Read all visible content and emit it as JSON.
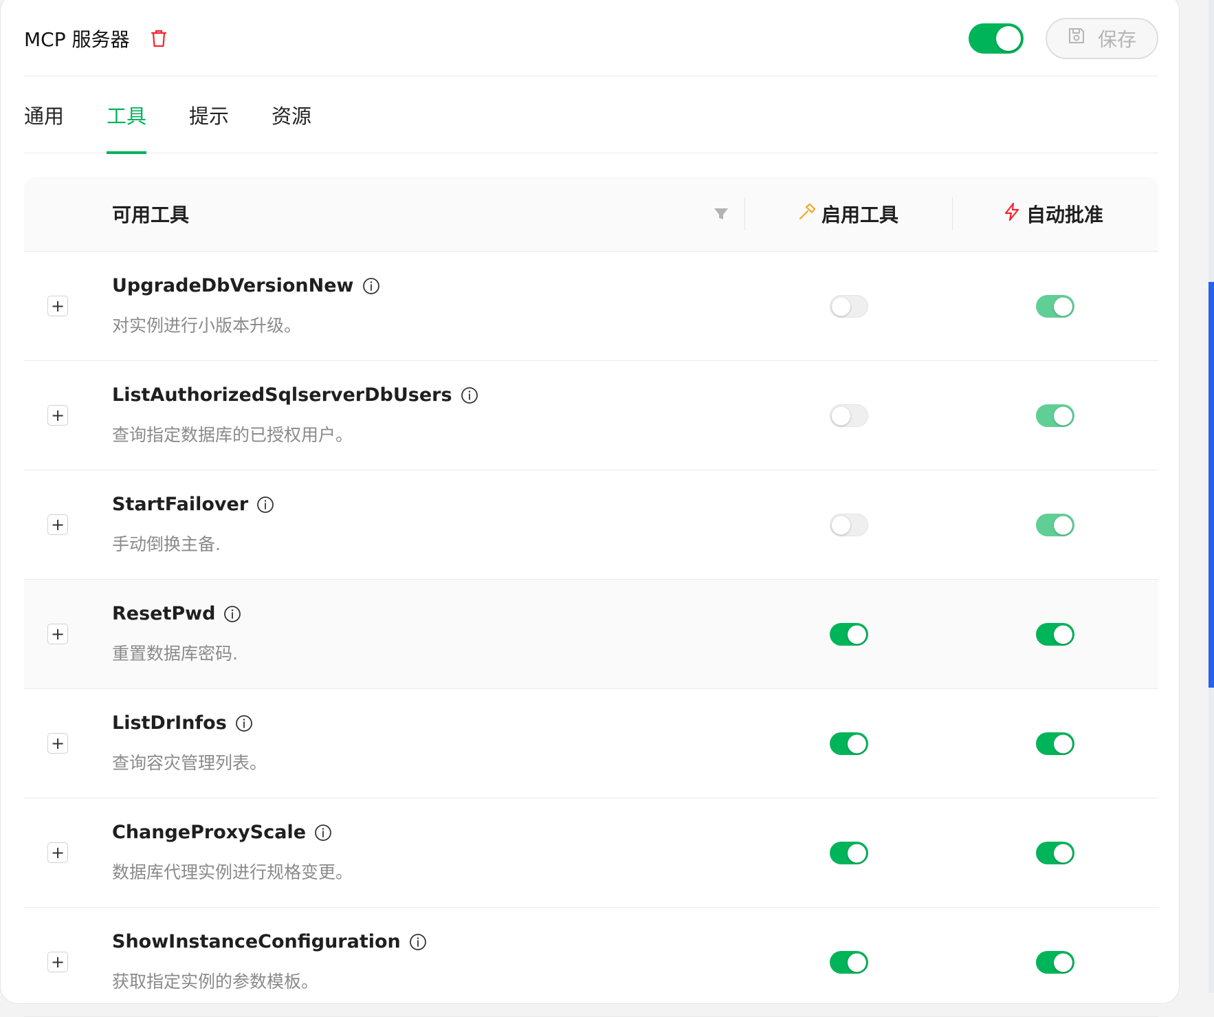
{
  "header": {
    "title": "MCP 服务器",
    "trash_icon": "trash-icon",
    "server_enabled": true,
    "save_label": "保存",
    "save_icon": "save-icon"
  },
  "tabs": [
    {
      "label": "通用",
      "active": false
    },
    {
      "label": "工具",
      "active": true
    },
    {
      "label": "提示",
      "active": false
    },
    {
      "label": "资源",
      "active": false
    }
  ],
  "table": {
    "col_tools": "可用工具",
    "col_enable": "启用工具",
    "col_auto": "自动批准",
    "filter_icon": "filter-icon",
    "enable_icon": "hammer-icon",
    "auto_icon": "lightning-icon",
    "rows": [
      {
        "name": "UpgradeDbVersionNew",
        "desc": "对实例进行小版本升级。",
        "enabled": false,
        "auto_approve": true
      },
      {
        "name": "ListAuthorizedSqlserverDbUsers",
        "desc": "查询指定数据库的已授权用户。",
        "enabled": false,
        "auto_approve": true
      },
      {
        "name": "StartFailover",
        "desc": "手动倒换主备.",
        "enabled": false,
        "auto_approve": true
      },
      {
        "name": "ResetPwd",
        "desc": "重置数据库密码.",
        "enabled": true,
        "auto_approve": true
      },
      {
        "name": "ListDrInfos",
        "desc": "查询容灾管理列表。",
        "enabled": true,
        "auto_approve": true
      },
      {
        "name": "ChangeProxyScale",
        "desc": "数据库代理实例进行规格变更。",
        "enabled": true,
        "auto_approve": true
      },
      {
        "name": "ShowInstanceConfiguration",
        "desc": "获取指定实例的参数模板。",
        "enabled": true,
        "auto_approve": true
      }
    ]
  },
  "colors": {
    "accent": "#00b459",
    "accent_light": "#5fcf96",
    "danger": "#f5222d",
    "warning": "#f5a623"
  }
}
